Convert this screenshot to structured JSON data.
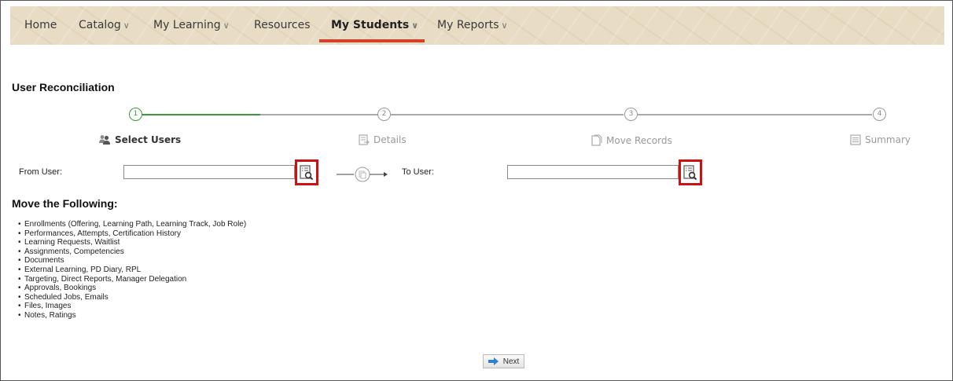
{
  "nav": {
    "items": [
      {
        "label": "Home",
        "chevron": ""
      },
      {
        "label": "Catalog",
        "chevron": "∨"
      },
      {
        "label": "My Learning",
        "chevron": "∨"
      },
      {
        "label": "Resources",
        "chevron": ""
      },
      {
        "label": "My Students",
        "chevron": "∨"
      },
      {
        "label": "My Reports",
        "chevron": "∨"
      }
    ],
    "active": "My Students"
  },
  "page": {
    "title": "User Reconciliation"
  },
  "steps": [
    {
      "number": "1",
      "label": "Select Users",
      "icon": "users-icon",
      "state": "current"
    },
    {
      "number": "2",
      "label": "Details",
      "icon": "details-icon",
      "state": "upcoming"
    },
    {
      "number": "3",
      "label": "Move Records",
      "icon": "move-records-icon",
      "state": "upcoming"
    },
    {
      "number": "4",
      "label": "Summary",
      "icon": "summary-icon",
      "state": "upcoming"
    }
  ],
  "form": {
    "from_label": "From User:",
    "from_value": "",
    "to_label": "To User:",
    "to_value": ""
  },
  "move": {
    "heading": "Move the Following:",
    "items": [
      "Enrollments (Offering, Learning Path, Learning Track, Job Role)",
      "Performances, Attempts, Certification History",
      "Learning Requests, Waitlist",
      "Assignments, Competencies",
      "Documents",
      "External Learning, PD Diary, RPL",
      "Targeting, Direct Reports, Manager Delegation",
      "Approvals, Bookings",
      "Scheduled Jobs, Emails",
      "Files, Images",
      "Notes, Ratings"
    ]
  },
  "actions": {
    "next_label": "Next"
  },
  "colors": {
    "accent_red": "#d2422b",
    "progress_green": "#3a9a3a",
    "highlight_red": "#cc1111"
  }
}
